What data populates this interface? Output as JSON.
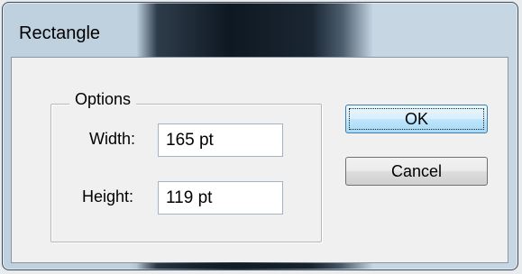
{
  "window": {
    "title": "Rectangle"
  },
  "options_group": {
    "legend": "Options",
    "width": {
      "label": "Width:",
      "value": "165 pt"
    },
    "height": {
      "label": "Height:",
      "value": "119 pt"
    }
  },
  "buttons": {
    "ok_label": "OK",
    "cancel_label": "Cancel"
  },
  "colors": {
    "client_background": "#f0f0f0",
    "ok_button_highlight": "#bee6fd",
    "frame_dark_glass": "#0e1822"
  }
}
